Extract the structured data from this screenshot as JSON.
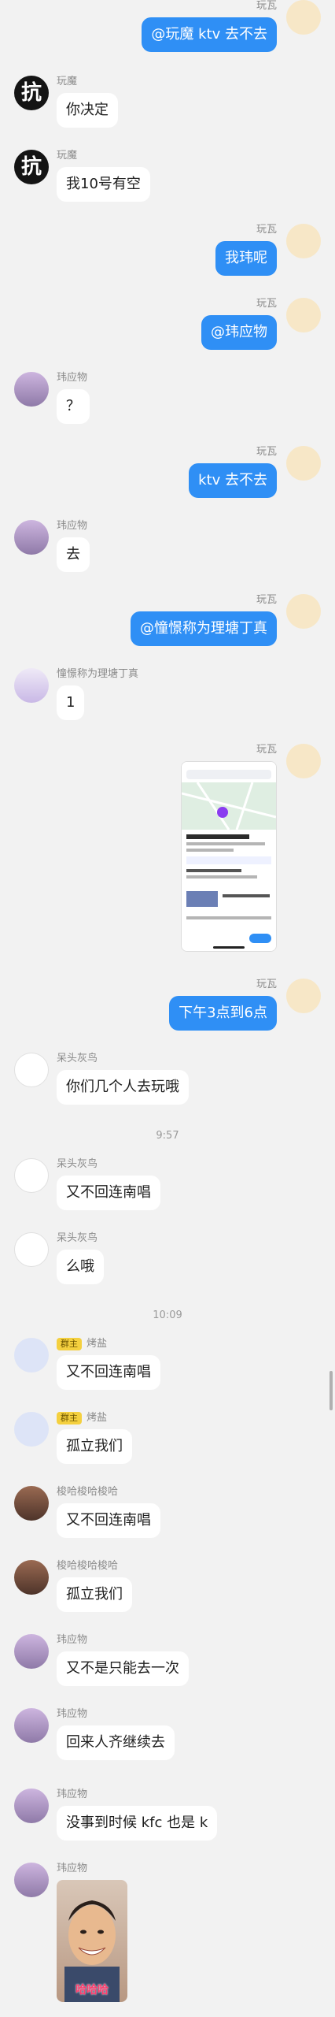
{
  "messages": [
    {
      "name": "玩瓦",
      "text": "@玩魔 ktv 去不去"
    },
    {
      "name": "玩魔",
      "text": "你决定"
    },
    {
      "name": "玩魔",
      "text": "我10号有空"
    },
    {
      "name": "玩瓦",
      "text": "我玮呢"
    },
    {
      "name": "玩瓦",
      "text": "@玮应物"
    },
    {
      "name": "玮应物",
      "text": "？"
    },
    {
      "name": "玩瓦",
      "text": "ktv 去不去"
    },
    {
      "name": "玮应物",
      "text": "去"
    },
    {
      "name": "玩瓦",
      "text": "@憧憬称为理塘丁真"
    },
    {
      "name": "憧憬称为理塘丁真",
      "text": "1"
    },
    {
      "name": "玩瓦",
      "text": ""
    },
    {
      "name": "玩瓦",
      "text": "下午3点到6点"
    },
    {
      "name": "呆头灰鸟",
      "text": "你们几个人去玩哦"
    },
    {
      "name": "呆头灰鸟",
      "text": "又不回连南唱"
    },
    {
      "name": "呆头灰鸟",
      "text": "么哦"
    },
    {
      "badge": "群主",
      "name": "烤盐",
      "text": "又不回连南唱"
    },
    {
      "badge": "群主",
      "name": "烤盐",
      "text": "孤立我们"
    },
    {
      "name": "梭哈梭哈梭哈",
      "text": "又不回连南唱"
    },
    {
      "name": "梭哈梭哈梭哈",
      "text": "孤立我们"
    },
    {
      "name": "玮应物",
      "text": "又不是只能去一次"
    },
    {
      "name": "玮应物",
      "text": "回来人齐继续去"
    },
    {
      "name": "玮应物",
      "text": "没事到时候 kfc 也是 k"
    },
    {
      "name": "玮应物",
      "text": ""
    }
  ],
  "avatar_kang_char": "抗",
  "time1": "9:57",
  "time2": "10:09",
  "photo_caption": "哈哈哈"
}
